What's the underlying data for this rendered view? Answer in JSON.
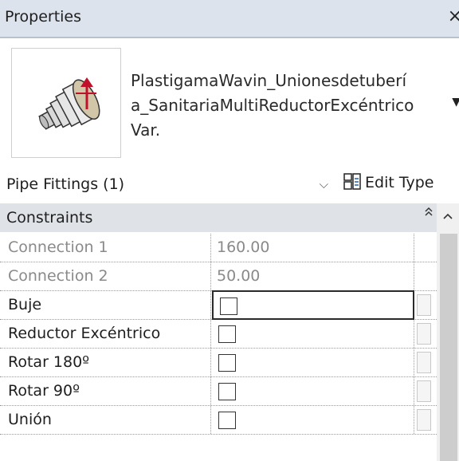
{
  "window": {
    "title": "Properties",
    "close_glyph": "×"
  },
  "type_selector": {
    "name": "PlastigamaWavin_Unionesdetuberí\na_SanitariaMultiReductorExcéntrico\nVar.",
    "dropdown_glyph": "▼",
    "thumbnail_icon": "pipe-reducer-fitting-icon"
  },
  "instance_filter": {
    "label": "Pipe Fittings (1)",
    "chevron": "⌵"
  },
  "edit_type": {
    "label": "Edit Type",
    "icon": "edit-type-icon"
  },
  "categories": [
    {
      "label": "Constraints",
      "collapse_glyph": "⌃⌃",
      "rows": [
        {
          "name": "Connection 1",
          "value": "160.00",
          "readonly": true
        },
        {
          "name": "Connection 2",
          "value": "50.00",
          "readonly": true
        },
        {
          "name": "Buje",
          "checked": false
        },
        {
          "name": "Reductor Excéntrico",
          "checked": false
        },
        {
          "name": "Rotar 180º",
          "checked": false
        },
        {
          "name": "Rotar 90º",
          "checked": false
        },
        {
          "name": "Unión",
          "checked": false
        }
      ]
    }
  ],
  "colors": {
    "header_bg": "#dde3ec",
    "category_bg": "#dfe3e8",
    "readonly_text": "#8a8a8a"
  }
}
